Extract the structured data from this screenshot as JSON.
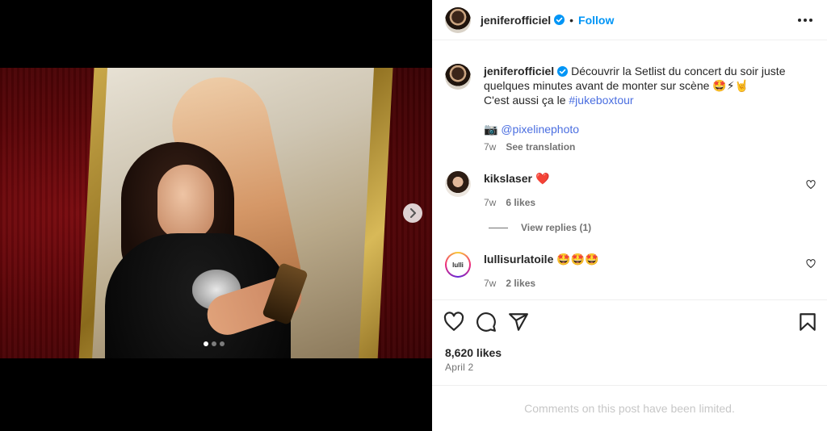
{
  "post": {
    "username": "jeniferofficiel",
    "verified": true,
    "follow_label": "Follow",
    "separator": "•"
  },
  "caption": {
    "username": "jeniferofficiel",
    "text": "Découvrir la Setlist du concert du soir juste quelques minutes avant de monter sur scène 🤩⚡🤘",
    "line2_prefix": "C'est aussi ça le ",
    "hashtag": "#jukeboxtour",
    "camera_emoji": "📷",
    "credit": "@pixelinephoto",
    "time": "7w",
    "translate": "See translation"
  },
  "comments": [
    {
      "username": "kikslaser",
      "text": "❤️",
      "time": "7w",
      "likes": "6 likes"
    },
    {
      "username": "lullisurlatoile",
      "text": "🤩🤩🤩",
      "time": "7w",
      "likes": "2 likes",
      "avatar_text": "lulli"
    }
  ],
  "view_replies": "View replies (1)",
  "stats": {
    "likes": "8,620 likes",
    "date": "April 2"
  },
  "footer": {
    "limited": "Comments on this post have been limited."
  },
  "carousel": {
    "slide_count": 3,
    "active_index": 0
  },
  "icons": [
    "more-icon",
    "like-icon",
    "comment-icon",
    "share-icon",
    "save-icon",
    "next-icon",
    "verified-icon",
    "heart-small-icon"
  ],
  "colors": {
    "accent": "#0095f6",
    "link": "#00376b",
    "text": "#262626",
    "muted": "#737373",
    "heart": "#ed4956"
  }
}
